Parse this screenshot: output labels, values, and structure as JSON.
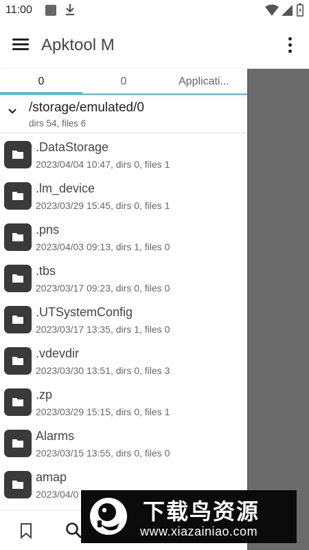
{
  "status_bar": {
    "time": "11:00"
  },
  "app_bar": {
    "title": "Apktool M"
  },
  "tabs": [
    {
      "label": "0"
    },
    {
      "label": "0"
    },
    {
      "label": "Applicati..."
    }
  ],
  "path": {
    "current": "/storage/emulated/0",
    "summary": "dirs 54, files 6"
  },
  "files": [
    {
      "name": ".DataStorage",
      "meta": "2023/04/04 10:47, dirs 0, files 1"
    },
    {
      "name": ".lm_device",
      "meta": "2023/03/29 15:45, dirs 0, files 1"
    },
    {
      "name": ".pns",
      "meta": "2023/04/03 09:13, dirs 1, files 0"
    },
    {
      "name": ".tbs",
      "meta": "2023/03/17 09:23, dirs 0, files 0"
    },
    {
      "name": ".UTSystemConfig",
      "meta": "2023/03/17 13:35, dirs 1, files 0"
    },
    {
      "name": ".vdevdir",
      "meta": "2023/03/30 13:51, dirs 0, files 3"
    },
    {
      "name": ".zp",
      "meta": "2023/03/29 15:15, dirs 0, files 1"
    },
    {
      "name": "Alarms",
      "meta": "2023/03/15 13:55, dirs 0, files 0"
    },
    {
      "name": "amap",
      "meta": "2023/04/0"
    }
  ],
  "watermark": {
    "cn_text": "下载鸟资源",
    "url": "www.xiazainiao.com"
  },
  "colors": {
    "accent": "#4fb8d6",
    "side_pane": "#6b6b6b",
    "folder_icon": "#3a3a3a"
  }
}
